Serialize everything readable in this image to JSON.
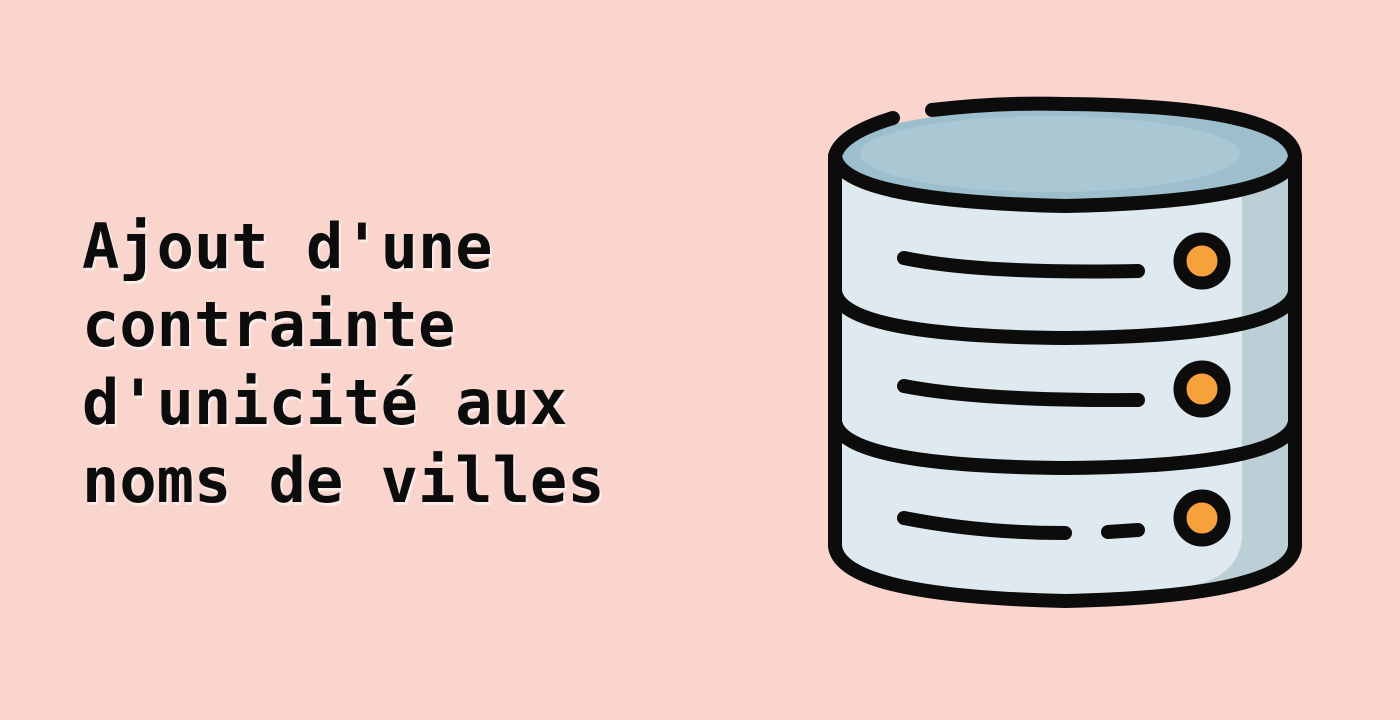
{
  "title": {
    "lines": [
      "Ajout d'une",
      "contrainte",
      "d'unicité aux",
      "noms de villes"
    ]
  },
  "illustration": {
    "icon": "database-server-icon",
    "colors": {
      "background": "#f9d5ce",
      "outline": "#0c0c0c",
      "top_fill": "#9dbfcd",
      "body_fill": "#deeaf0",
      "body_shade": "#bccfd6",
      "indicator": "#f6a13c"
    }
  }
}
